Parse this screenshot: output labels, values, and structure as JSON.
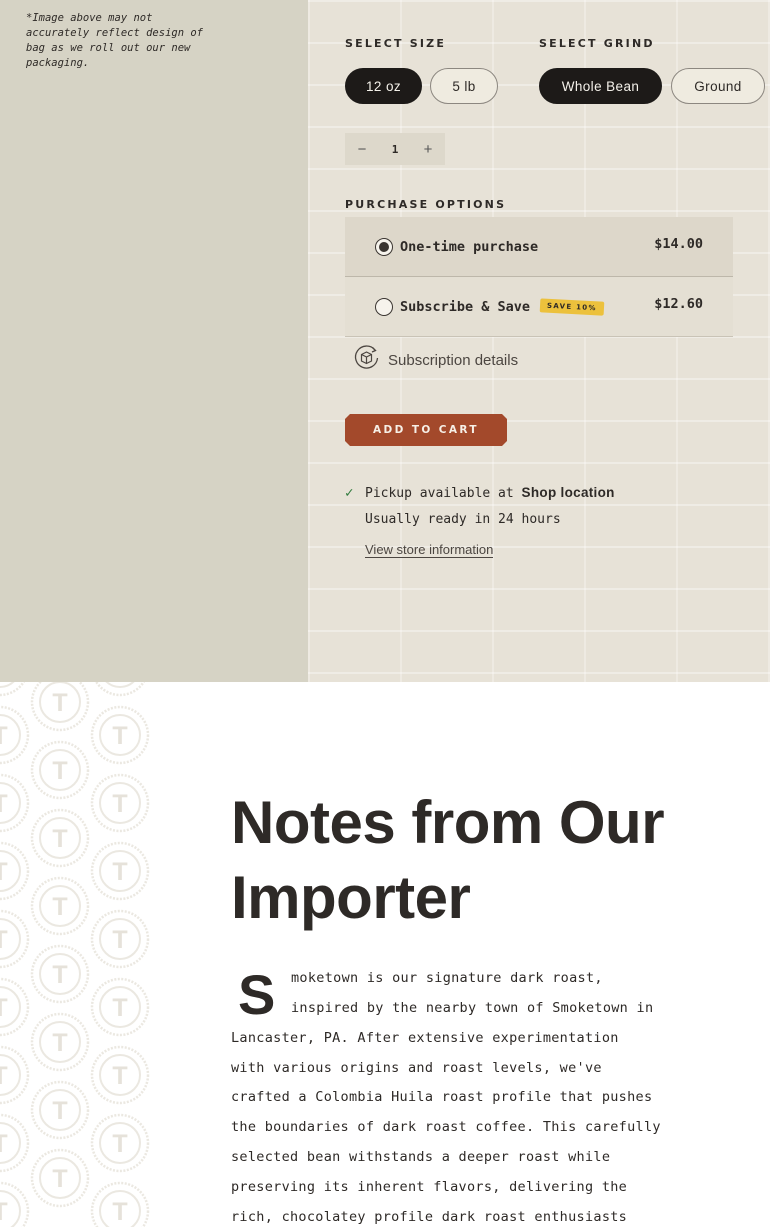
{
  "disclaimer": [
    "*Image above may not",
    "accurately reflect design of",
    "bag as we roll out our new",
    "packaging."
  ],
  "size": {
    "label": "SELECT SIZE",
    "options": [
      "12 oz",
      "5 lb"
    ],
    "selected": "12 oz"
  },
  "grind": {
    "label": "SELECT GRIND",
    "options": [
      "Whole Bean",
      "Ground"
    ],
    "selected": "Whole Bean"
  },
  "quantity": {
    "minus_icon": "minus-icon",
    "value": "1",
    "plus_icon": "plus-icon"
  },
  "purchase": {
    "label": "PURCHASE OPTIONS",
    "one_time": {
      "label": "One-time purchase",
      "price": "$14.00",
      "selected": true
    },
    "subscribe": {
      "label": "Subscribe & Save",
      "badge": "SAVE 10%",
      "price": "$12.60",
      "selected": false
    },
    "details_link": "Subscription details",
    "details_icon": "subscription-box-icon"
  },
  "add_to_cart": "ADD TO CART",
  "pickup": {
    "check_icon": "checkmark-icon",
    "prefix": "Pickup available at ",
    "location": "Shop location",
    "ready": "Usually ready in 24 hours",
    "link": "View store information"
  },
  "notes": {
    "title_line1": "Notes from Our",
    "title_line2": "Importer",
    "dropcap": "S",
    "lines": [
      "moketown is our signature dark roast,",
      "inspired by the nearby town of Smoketown in",
      "Lancaster, PA. After extensive experimentation",
      "with various origins and roast levels, we've",
      "crafted a Colombia Huila roast profile that pushes",
      "the boundaries of dark roast coffee. This carefully",
      "selected bean withstands a deeper roast while",
      "preserving its inherent flavors, delivering the",
      "rich, chocolatey profile dark roast enthusiasts"
    ],
    "pattern_letter": "T"
  },
  "colors": {
    "accent": "#a3492b",
    "badge": "#ecc13c",
    "check": "#2f7a3c",
    "dark": "#1d1a18"
  }
}
